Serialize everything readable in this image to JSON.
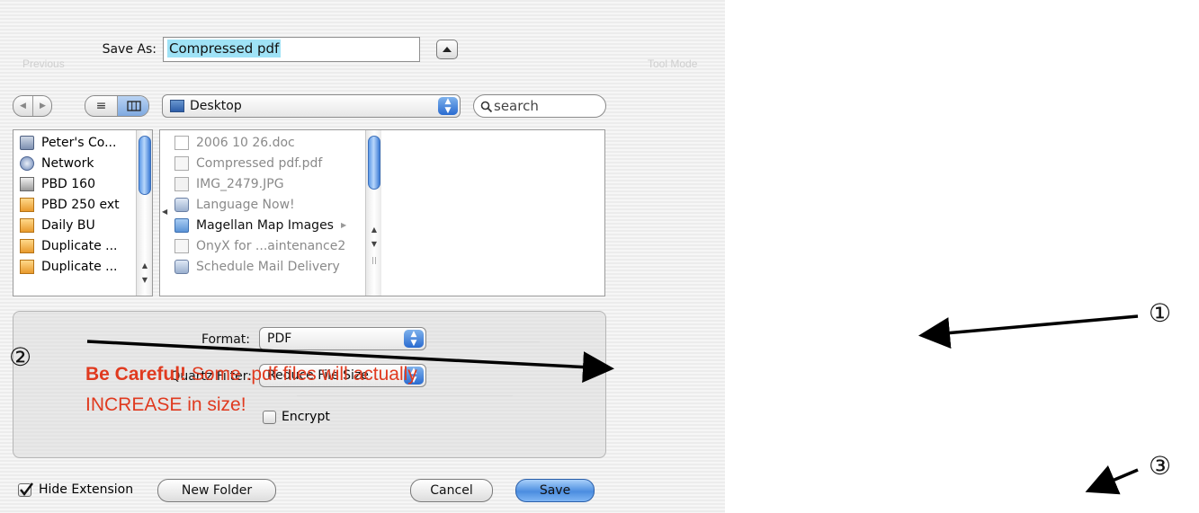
{
  "dialog": {
    "save_as_label": "Save As:",
    "filename": "Compressed pdf",
    "location": "Desktop",
    "search_placeholder": "search",
    "background_toolbar": [
      "Previous",
      "Tool Mode"
    ],
    "sidebar": [
      {
        "label": "Peter's Co...",
        "icon": "computer-icon"
      },
      {
        "label": "Network",
        "icon": "network-icon"
      },
      {
        "label": "PBD 160",
        "icon": "hard-drive-icon"
      },
      {
        "label": "PBD 250 ext",
        "icon": "external-drive-icon"
      },
      {
        "label": "Daily BU",
        "icon": "external-drive-icon"
      },
      {
        "label": "Duplicate ...",
        "icon": "external-drive-icon"
      },
      {
        "label": "Duplicate ...",
        "icon": "external-drive-icon"
      }
    ],
    "files": [
      {
        "label": "2006 10 26.doc",
        "icon": "document-icon",
        "enabled": false
      },
      {
        "label": "Compressed pdf.pdf",
        "icon": "pdf-file-icon",
        "enabled": false
      },
      {
        "label": "IMG_2479.JPG",
        "icon": "image-file-icon",
        "enabled": false
      },
      {
        "label": "Language Now!",
        "icon": "app-icon",
        "enabled": false
      },
      {
        "label": "Magellan Map Images",
        "icon": "folder-icon",
        "enabled": true
      },
      {
        "label": "OnyX for ...aintenance2",
        "icon": "pdf-file-icon",
        "enabled": false
      },
      {
        "label": "Schedule Mail Delivery",
        "icon": "app-icon",
        "enabled": false
      }
    ],
    "format_label": "Format:",
    "format_value": "PDF",
    "quartz_label": "Quartz Filter:",
    "quartz_value": "Reduce File Size",
    "encrypt_label": "Encrypt",
    "encrypt_checked": false,
    "hide_extension_label": "Hide Extension",
    "hide_extension_checked": true,
    "new_folder_label": "New Folder",
    "cancel_label": "Cancel",
    "save_label": "Save"
  },
  "annotations": {
    "marker_1": "①",
    "marker_2": "②",
    "marker_3": "③",
    "warning_bold": "Be Careful!",
    "warning_text": " Some .pdf files will actually INCREASE in size!"
  },
  "colors": {
    "warning": "#e03a1f",
    "selection": "#9fe2f6",
    "accent_blue": "#3b7bd6"
  }
}
